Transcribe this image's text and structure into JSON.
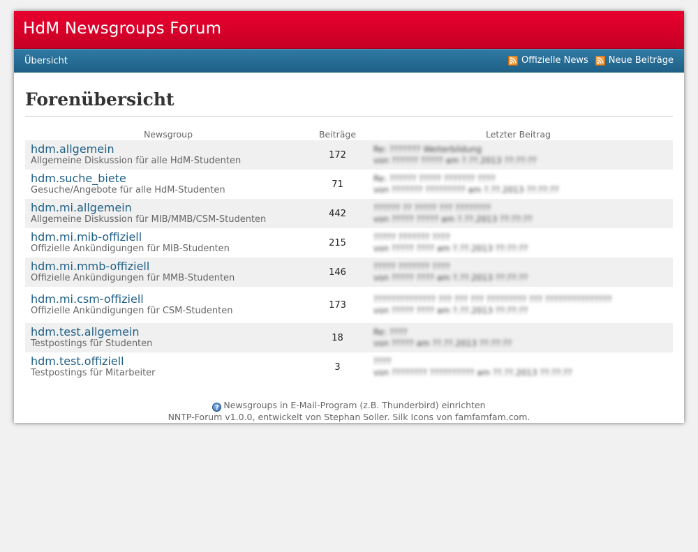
{
  "header": {
    "title": "HdM Newsgroups Forum"
  },
  "nav": {
    "overview": "Übersicht",
    "official_news": "Offizielle News",
    "new_posts": "Neue Beiträge"
  },
  "page": {
    "heading": "Forenübersicht"
  },
  "table": {
    "columns": [
      "Newsgroup",
      "Beiträge",
      "Letzter Beitrag"
    ],
    "rows": [
      {
        "name": "hdm.allgemein",
        "desc": "Allgemeine Diskussion für alle HdM-Studenten",
        "count": "172",
        "last1": "Re: ??????? Weiterbildung",
        "last2": "von ?????? ????? am ?.??.2013 ??:??:??"
      },
      {
        "name": "hdm.suche_biete",
        "desc": "Gesuche/Angebote für alle HdM-Studenten",
        "count": "71",
        "last1": "Re: ?????? ????? ??????? ????",
        "last2": "von ??????? ????????? am ?.??.2013 ??:??:??"
      },
      {
        "name": "hdm.mi.allgemein",
        "desc": "Allgemeine Diskussion für MIB/MMB/CSM-Studenten",
        "count": "442",
        "last1": "?????? ?? ????? ??? ????????",
        "last2": "von ????? ????? am ?.??.2013 ??:??:??"
      },
      {
        "name": "hdm.mi.mib-offiziell",
        "desc": "Offizielle Ankündigungen für MIB-Studenten",
        "count": "215",
        "last1": "????? ??????? ????",
        "last2": "von ????? ???? am ?.??.2013 ??:??:??"
      },
      {
        "name": "hdm.mi.mmb-offiziell",
        "desc": "Offizielle Ankündigungen für MMB-Studenten",
        "count": "146",
        "last1": "????? ??????? ????",
        "last2": "von ????? ???? am ?.??.2013 ??:??:??"
      },
      {
        "name": "hdm.mi.csm-offiziell",
        "desc": "Offizielle Ankündigungen für CSM-Studenten",
        "count": "173",
        "last1": "?????????????? ??? ??? ??? ????????? ??? ???????????????",
        "last2": "von ????? ???? am ?.??.2013 ??:??:??"
      },
      {
        "name": "hdm.test.allgemein",
        "desc": "Testpostings für Studenten",
        "count": "18",
        "last1": "Re: ????",
        "last2": "von ????? am ??.??.2013 ??:??:??"
      },
      {
        "name": "hdm.test.offiziell",
        "desc": "Testpostings für Mitarbeiter",
        "count": "3",
        "last1": "????",
        "last2": "von ???????? ?????????? am ??.??.2013 ??:??:??"
      }
    ]
  },
  "footer": {
    "help_link": "Newsgroups in E-Mail-Program (z.B. Thunderbird) einrichten",
    "credits": "NNTP-Forum v1.0.0, entwickelt von Stephan Soller. Silk Icons von famfamfam.com."
  },
  "icons": {
    "feed": "rss-feed-icon",
    "help": "help-icon"
  },
  "colors": {
    "header": "#d9002a",
    "navbar": "#286c95",
    "link": "#1f5f86"
  }
}
